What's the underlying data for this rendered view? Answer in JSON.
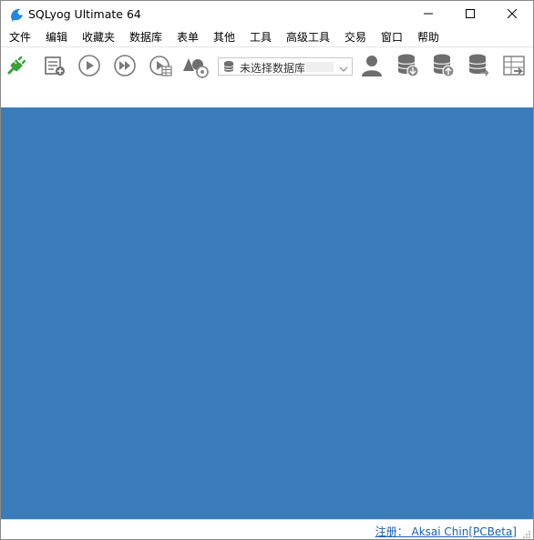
{
  "window": {
    "title": "SQLyog Ultimate 64",
    "accent_color": "#1e88e5",
    "workspace_color": "#3b7dbb"
  },
  "title_buttons": {
    "minimize_icon": "minimize-icon",
    "maximize_icon": "maximize-icon",
    "close_icon": "close-icon"
  },
  "menu": {
    "items": [
      "文件",
      "编辑",
      "收藏夹",
      "数据库",
      "表单",
      "其他",
      "工具",
      "高级工具",
      "交易",
      "窗口",
      "帮助"
    ]
  },
  "toolbar": {
    "buttons": [
      "new-connection-icon",
      "new-query-icon",
      "execute-query-icon",
      "execute-all-icon",
      "execute-edit-results-icon",
      "schema-designer-icon",
      "user-manager-icon",
      "backup-database-icon",
      "restore-database-icon",
      "copy-database-icon",
      "import-external-data-icon"
    ],
    "database_select": {
      "value": "未选择数据库"
    }
  },
  "status": {
    "registration": "注册： Aksai Chin[PCBeta]"
  }
}
